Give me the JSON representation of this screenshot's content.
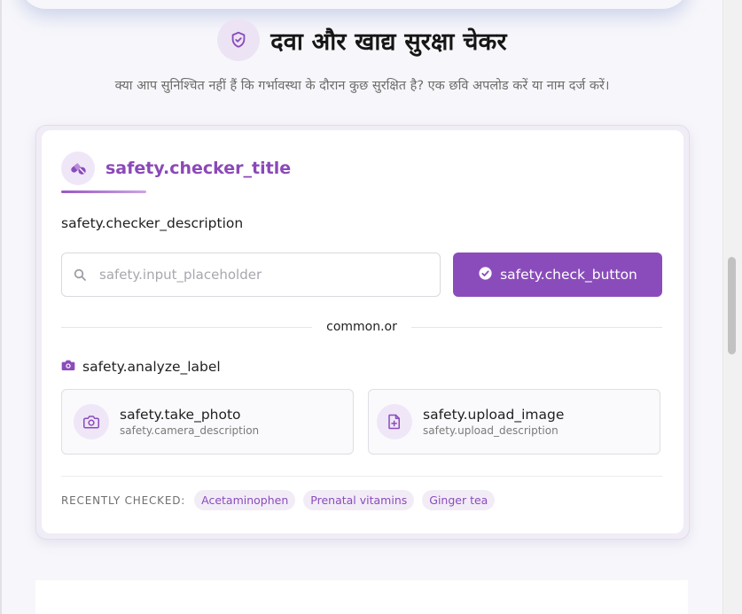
{
  "header": {
    "title": "दवा और खाद्य सुरक्षा चेकर",
    "subtitle": "क्या आप सुनिश्चित नहीं हैं कि गर्भावस्था के दौरान कुछ सुरक्षित है? एक छवि अपलोड करें या नाम दर्ज करें।",
    "icon": "shield-check-icon"
  },
  "card": {
    "title": "safety.checker_title",
    "title_icon": "pills-icon",
    "description": "safety.checker_description",
    "search": {
      "placeholder": "safety.input_placeholder",
      "value": ""
    },
    "check_button_label": "safety.check_button",
    "divider_text": "common.or",
    "analyze_label": "safety.analyze_label",
    "options": [
      {
        "title": "safety.take_photo",
        "subtitle": "safety.camera_description",
        "icon": "camera-icon"
      },
      {
        "title": "safety.upload_image",
        "subtitle": "safety.upload_description",
        "icon": "file-plus-icon"
      }
    ],
    "recent": {
      "label": "RECENTLY CHECKED:",
      "items": [
        "Acetaminophen",
        "Prenatal vitamins",
        "Ginger tea"
      ]
    }
  },
  "colors": {
    "accent": "#8a4cbb",
    "accent_light": "#efe6f7",
    "text": "#1f1f1f",
    "muted": "#6b6b6b"
  }
}
